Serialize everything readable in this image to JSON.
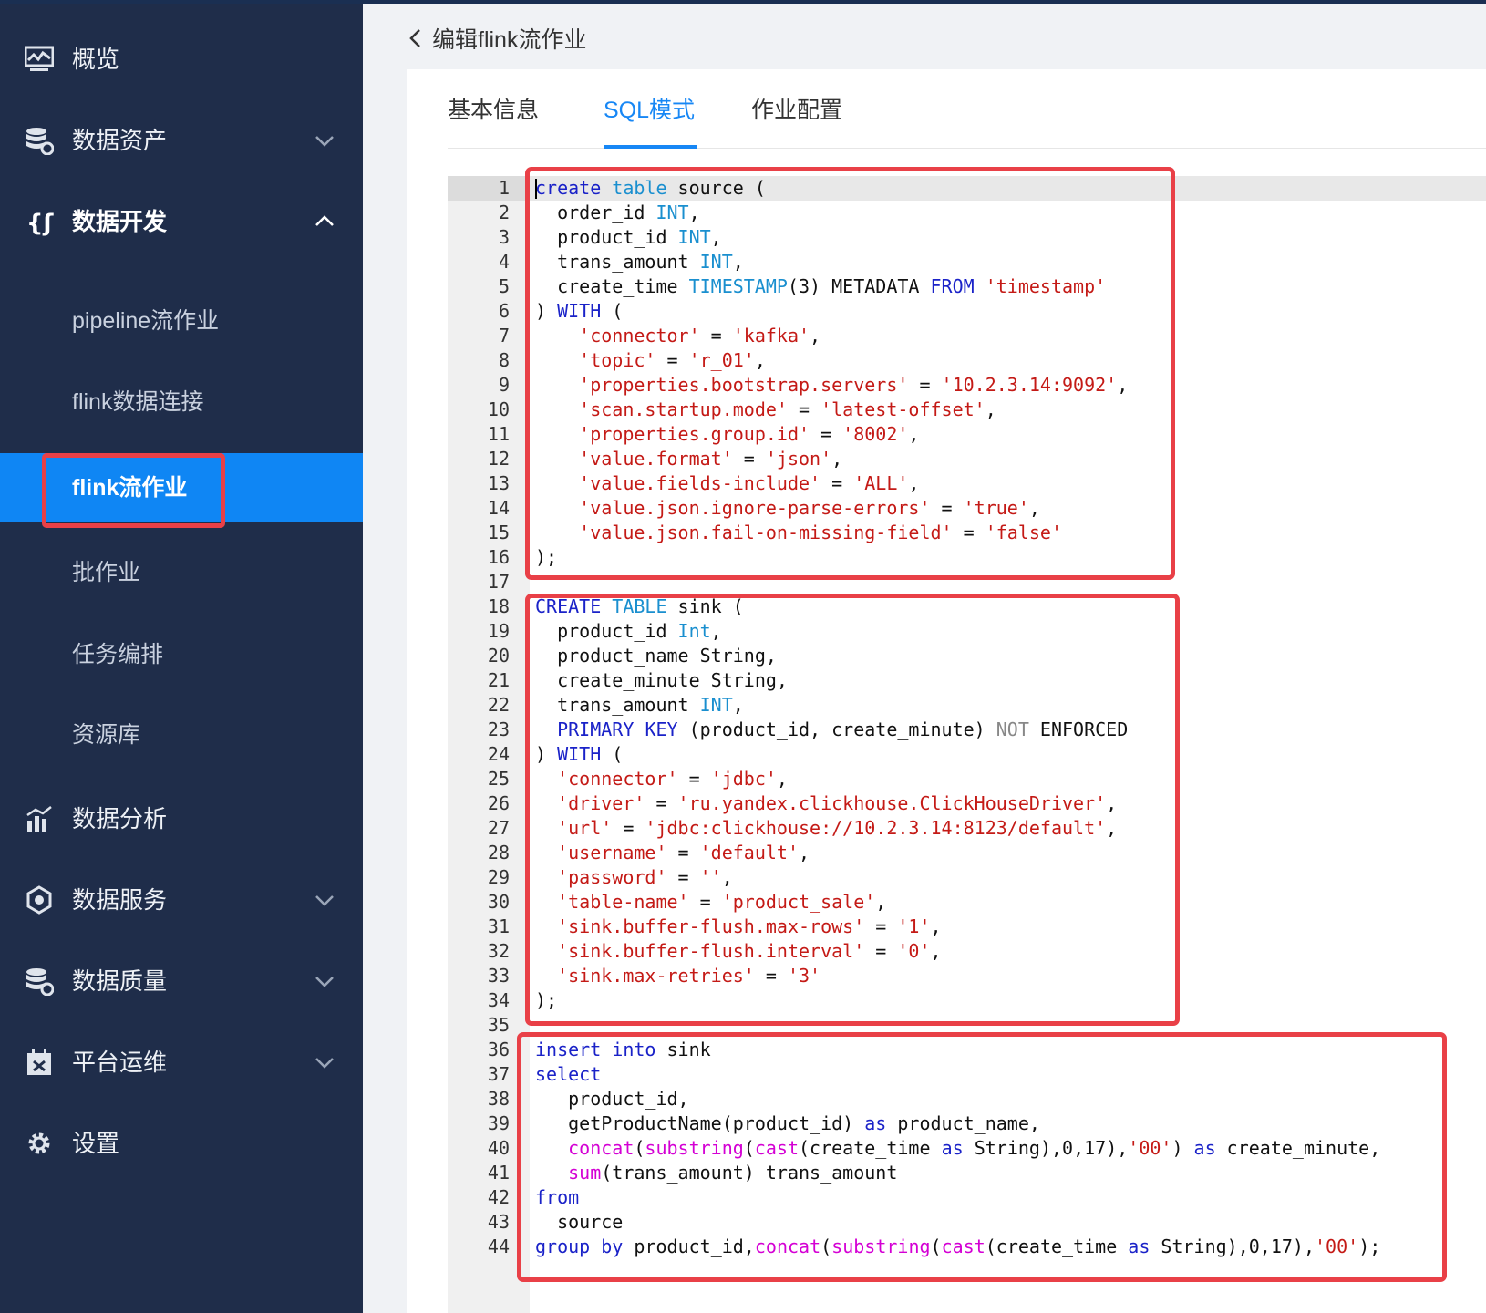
{
  "sidebar": {
    "items": [
      {
        "label": "概览",
        "icon": "monitor-chart-icon"
      },
      {
        "label": "数据资产",
        "icon": "database-icon"
      },
      {
        "label": "数据开发",
        "icon": "code-dev-icon"
      },
      {
        "label": "数据分析",
        "icon": "bar-chart-icon"
      },
      {
        "label": "数据服务",
        "icon": "service-gear-icon"
      },
      {
        "label": "数据质量",
        "icon": "database-quality-icon"
      },
      {
        "label": "平台运维",
        "icon": "calendar-ops-icon"
      },
      {
        "label": "设置",
        "icon": "gear-icon"
      }
    ],
    "sub_items": [
      {
        "label": "pipeline流作业"
      },
      {
        "label": "flink数据连接"
      },
      {
        "label": "flink流作业"
      },
      {
        "label": "批作业"
      },
      {
        "label": "任务编排"
      },
      {
        "label": "资源库"
      }
    ]
  },
  "header": {
    "back_title": "编辑flink流作业"
  },
  "tabs": [
    {
      "label": "基本信息"
    },
    {
      "label": "SQL模式"
    },
    {
      "label": "作业配置"
    }
  ],
  "active_tab": "SQL模式",
  "active_sub_item": "flink流作业",
  "colors": {
    "sidebar_bg": "#1f2d4a",
    "active_blue": "#0f86f4",
    "highlight_red": "#e94047",
    "keyword": "#1a22c8",
    "type": "#1a8fcf",
    "string": "#c41a16",
    "function": "#d400d4"
  },
  "editor": {
    "lines": [
      "create table source (",
      "  order_id INT,",
      "  product_id INT,",
      "  trans_amount INT,",
      "  create_time TIMESTAMP(3) METADATA FROM 'timestamp'",
      ") WITH (",
      "    'connector' = 'kafka',",
      "    'topic' = 'r_01',",
      "    'properties.bootstrap.servers' = '10.2.3.14:9092',",
      "    'scan.startup.mode' = 'latest-offset',",
      "    'properties.group.id' = '8002',",
      "    'value.format' = 'json',",
      "    'value.fields-include' = 'ALL',",
      "    'value.json.ignore-parse-errors' = 'true',",
      "    'value.json.fail-on-missing-field' = 'false'",
      ");",
      "",
      "CREATE TABLE sink (",
      "  product_id Int,",
      "  product_name String,",
      "  create_minute String,",
      "  trans_amount INT,",
      "  PRIMARY KEY (product_id, create_minute) NOT ENFORCED",
      ") WITH (",
      "  'connector' = 'jdbc',",
      "  'driver' = 'ru.yandex.clickhouse.ClickHouseDriver',",
      "  'url' = 'jdbc:clickhouse://10.2.3.14:8123/default',",
      "  'username' = 'default',",
      "  'password' = '',",
      "  'table-name' = 'product_sale',",
      "  'sink.buffer-flush.max-rows' = '1',",
      "  'sink.buffer-flush.interval' = '0',",
      "  'sink.max-retries' = '3'",
      ");",
      "",
      "insert into sink",
      "select",
      "   product_id,",
      "   getProductName(product_id) as product_name,",
      "   concat(substring(cast(create_time as String),0,17),'00') as create_minute,",
      "   sum(trans_amount) trans_amount",
      "from",
      "  source",
      "group by product_id,concat(substring(cast(create_time as String),0,17),'00');"
    ]
  }
}
